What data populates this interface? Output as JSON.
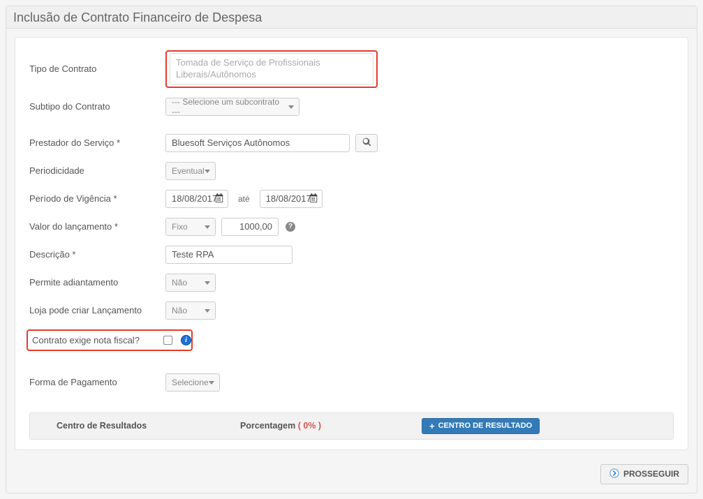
{
  "page": {
    "title": "Inclusão de Contrato Financeiro de Despesa"
  },
  "labels": {
    "tipo_contrato": "Tipo de Contrato",
    "subtipo_contrato": "Subtipo do Contrato",
    "prestador_servico": "Prestador do Serviço *",
    "periodicidade": "Periodicidade",
    "periodo_vigencia": "Período de Vigência *",
    "ate": "até",
    "valor_lancamento": "Valor do lançamento *",
    "descricao": "Descrição *",
    "permite_adiantamento": "Permite adiantamento",
    "loja_criar_lancamento": "Loja pode criar Lançamento",
    "contrato_exige_nf": "Contrato exige nota fiscal?",
    "forma_pagamento": "Forma de Pagamento"
  },
  "fields": {
    "tipo_contrato": "Tomada de Serviço de Profissionais Liberais/Autônomos",
    "subtipo_placeholder": "--- Selecione um subcontrato ---",
    "prestador_value": "Bluesoft Serviços Autônomos",
    "periodicidade": "Eventual",
    "data_inicio": "18/08/2017",
    "data_fim": "18/08/2017",
    "valor_tipo": "Fixo",
    "valor": "1000,00",
    "descricao": "Teste RPA",
    "permite_adiantamento": "Não",
    "loja_criar_lancamento": "Não",
    "contrato_exige_nf_checked": false,
    "forma_pagamento": "Selecione"
  },
  "results": {
    "col_centro": "Centro de Resultados",
    "col_porcentagem": "Porcentagem",
    "porc_value": "( 0% )",
    "add_button": "CENTRO DE RESULTADO"
  },
  "footer": {
    "prosseguir": "PROSSEGUIR"
  },
  "icons": {
    "search": "search-icon",
    "calendar": "calendar-icon",
    "help": "help-icon",
    "info": "info-icon",
    "plus": "plus-icon",
    "arrow_right": "arrow-right-icon"
  }
}
